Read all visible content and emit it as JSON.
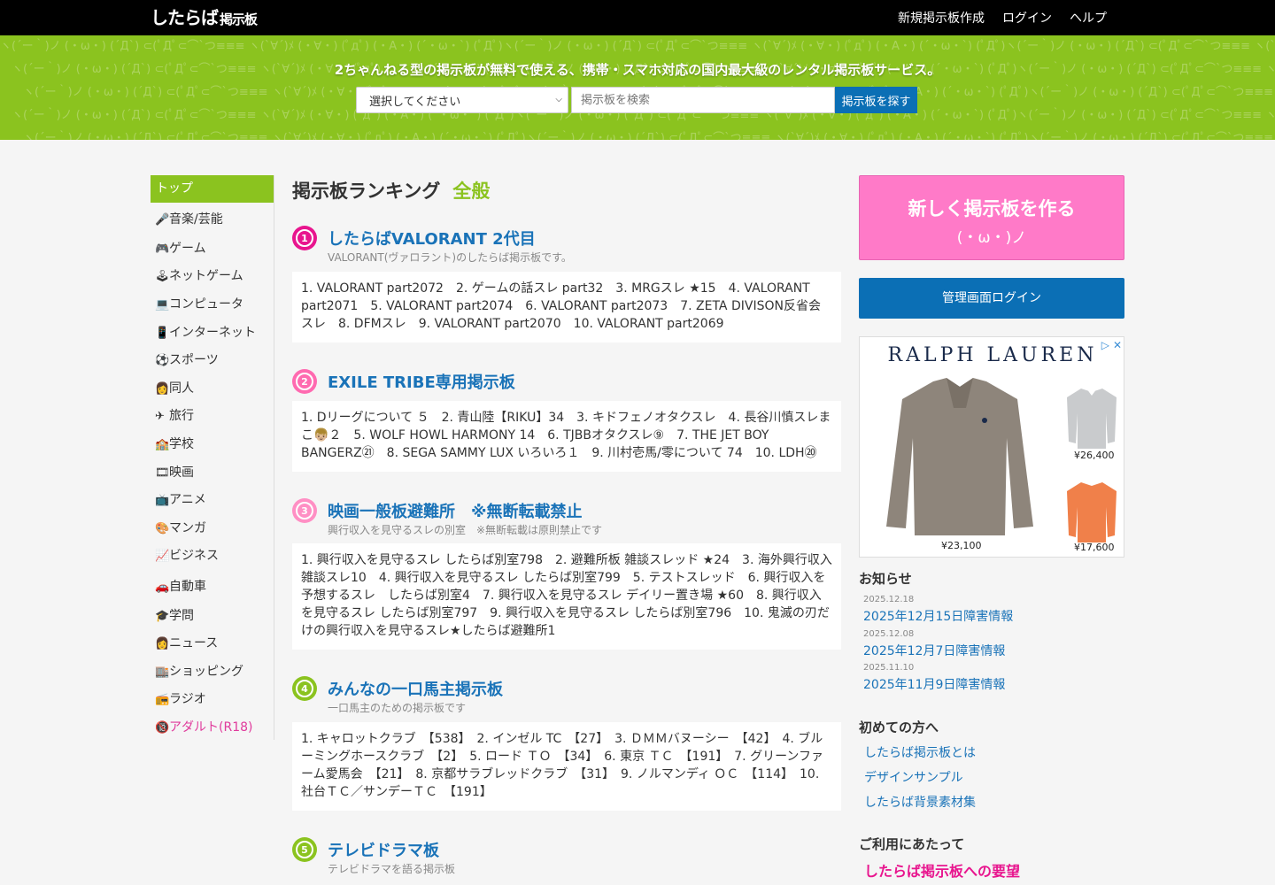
{
  "header": {
    "logo_main": "したらば",
    "logo_sub": "掲示板",
    "nav": [
      "新規掲示板作成",
      "ログイン",
      "ヘルプ"
    ]
  },
  "hero": {
    "tagline": "2ちゃんねる型の掲示板が無料で使える、携帯・スマホ対応の国内最大級のレンタル掲示板サービス。",
    "select_value": "選択してください",
    "search_placeholder": "掲示板を検索",
    "search_button": "掲示板を探す",
    "bg_pattern": "ヽ(´ー｀)ノ (・ω・) (´Д`) ⊂(ﾟДﾟ⊂⌒`つ≡≡≡ ヽ(`∀´)ﾒ (・∀・) (ﾟдﾟ) (・A・) (´・ω・`) (ﾟДﾟ)"
  },
  "sidebar": {
    "top_label": "トップ",
    "items": [
      {
        "icon": "🎤",
        "label": "音楽/芸能"
      },
      {
        "icon": "🎮",
        "label": "ゲーム"
      },
      {
        "icon": "🕹",
        "label": "ネットゲーム"
      },
      {
        "icon": "💻",
        "label": "コンピュータ"
      },
      {
        "icon": "📱",
        "label": "インターネット"
      },
      {
        "icon": "⚽",
        "label": "スポーツ"
      },
      {
        "icon": "👩",
        "label": "同人"
      },
      {
        "icon": "✈",
        "label": "旅行"
      },
      {
        "icon": "🏫",
        "label": "学校"
      },
      {
        "icon": "🎞",
        "label": "映画"
      },
      {
        "icon": "📺",
        "label": "アニメ"
      },
      {
        "icon": "🎨",
        "label": "マンガ"
      },
      {
        "icon": "📈",
        "label": "ビジネス"
      },
      {
        "icon": "🚗",
        "label": "自動車"
      },
      {
        "icon": "🎓",
        "label": "学問"
      },
      {
        "icon": "👩",
        "label": "ニュース"
      },
      {
        "icon": "🏬",
        "label": "ショッピング"
      },
      {
        "icon": "📻",
        "label": "ラジオ"
      },
      {
        "icon": "🔞",
        "label": "アダルト(R18)"
      }
    ]
  },
  "main": {
    "title": "掲示板ランキング",
    "category": "全般",
    "rankings": [
      {
        "rank": "1",
        "color": "#e8158e",
        "title": "したらばVALORANT 2代目",
        "desc": "VALORANT(ヴァロラント)のしたらば掲示板です。",
        "threads": "1. VALORANT part2072　2. ゲームの話スレ part32　3. MRGスレ ★15　4. VALORANT part2071　5. VALORANT part2074　6. VALORANT part2073　7. ZETA DIVISON反省会スレ　8. DFMスレ　9. VALORANT part2070　10. VALORANT part2069"
      },
      {
        "rank": "2",
        "color": "#ff6ab0",
        "title": "EXILE TRIBE専用掲示板",
        "desc": "",
        "threads": "1. Dリーグについて ５　2. 青山陸【RIKU】34　3. キドフェノオタクスレ　4. 長谷川慎スレまこ👦🏼２　5. WOLF HOWL HARMONY 14　6. TJBBオタクスレ⑨　7. THE JET BOY BANGERZ㉑　8. SEGA SAMMY LUX いろいろ１　9. 川村壱馬/零について 74　10. LDH⑳"
      },
      {
        "rank": "3",
        "color": "#ff8fc4",
        "title": "映画一般板避難所　※無断転載禁止",
        "desc": "興行収入を見守るスレの別室　※無断転載は原則禁止です",
        "threads": "1. 興行収入を見守るスレ したらば別室798　2. 避難所板 雑談スレッド ★24　3. 海外興行収入雑談スレ10　4. 興行収入を見守るスレ したらば別室799　5. テストスレッド　6. 興行収入を予想するスレ　したらば別室4　7. 興行収入を見守るスレ デイリー置き場 ★60　8. 興行収入を見守るスレ したらば別室797　9. 興行収入を見守るスレ したらば別室796　10. 鬼滅の刃だけの興行収入を見守るスレ★したらば避難所1"
      },
      {
        "rank": "4",
        "color": "#8bc31f",
        "title": "みんなの一口馬主掲示板",
        "desc": "一口馬主のための掲示板です",
        "threads": "1. キャロットクラブ　【538】　2. インゼル TC　【27】　3. ＤＭＭバヌーシー　【42】　4. ブルーミングホースクラブ　【2】　5. ロード ＴＯ　【34】　6. 東京 ＴＣ　【191】　7. グリーンファーム愛馬会　【21】　8. 京都サラブレッドクラブ　【31】　9. ノルマンディ ＯＣ　【114】　10. 社台ＴＣ／サンデーＴＣ　【191】"
      },
      {
        "rank": "5",
        "color": "#8bc31f",
        "title": "テレビドラマ板",
        "desc": "テレビドラマを語る掲示板",
        "threads": ""
      }
    ]
  },
  "right": {
    "cta_line1": "新しく掲示板を作る",
    "cta_line2": "(・ω・)ノ",
    "admin_login": "管理画面ログイン",
    "ad": {
      "brand": "RALPH LAUREN",
      "price_main": "¥23,100",
      "price_2": "¥26,400",
      "price_3": "¥17,600"
    },
    "news_title": "お知らせ",
    "news": [
      {
        "date": "2025.12.18",
        "title": "2025年12月15日障害情報"
      },
      {
        "date": "2025.12.08",
        "title": "2025年12月7日障害情報"
      },
      {
        "date": "2025.11.10",
        "title": "2025年11月9日障害情報"
      }
    ],
    "guide_title": "初めての方へ",
    "guide_links": [
      "したらば掲示板とは",
      "デザインサンプル",
      "したらば背景素材集"
    ],
    "usage_title": "ご利用にあたって",
    "request_link": "したらば掲示板への要望"
  }
}
